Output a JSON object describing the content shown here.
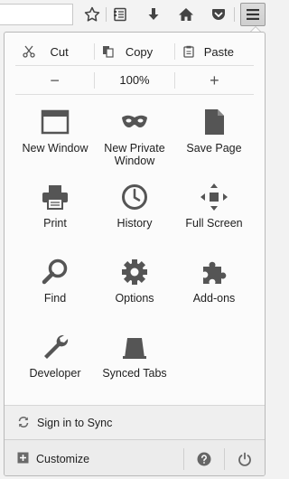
{
  "toolbar": {
    "buttons": [
      {
        "name": "star-icon",
        "label": "Bookmark this page"
      },
      {
        "name": "reader-list-icon",
        "label": "Show your bookmarks"
      },
      {
        "name": "download-icon",
        "label": "Downloads"
      },
      {
        "name": "home-icon",
        "label": "Home"
      },
      {
        "name": "pocket-icon",
        "label": "Pocket"
      },
      {
        "name": "hamburger-menu-icon",
        "label": "Open menu"
      }
    ]
  },
  "edit": {
    "cut": "Cut",
    "copy": "Copy",
    "paste": "Paste"
  },
  "zoom": {
    "minus": "−",
    "level": "100%",
    "plus": "+"
  },
  "items": [
    {
      "label": "New Window",
      "icon": "new-window-icon"
    },
    {
      "label": "New Private Window",
      "icon": "private-mask-icon"
    },
    {
      "label": "Save Page",
      "icon": "save-page-icon"
    },
    {
      "label": "Print",
      "icon": "printer-icon"
    },
    {
      "label": "History",
      "icon": "clock-icon"
    },
    {
      "label": "Full Screen",
      "icon": "fullscreen-icon"
    },
    {
      "label": "Find",
      "icon": "magnifier-icon"
    },
    {
      "label": "Options",
      "icon": "gear-icon"
    },
    {
      "label": "Add-ons",
      "icon": "puzzle-icon"
    },
    {
      "label": "Developer",
      "icon": "wrench-icon"
    },
    {
      "label": "Synced Tabs",
      "icon": "synced-tabs-icon"
    }
  ],
  "footer": {
    "sync": "Sign in to Sync",
    "customize": "Customize"
  },
  "colors": {
    "icon": "#555555",
    "panel": "#fbfbfb",
    "footer": "#ececec"
  }
}
